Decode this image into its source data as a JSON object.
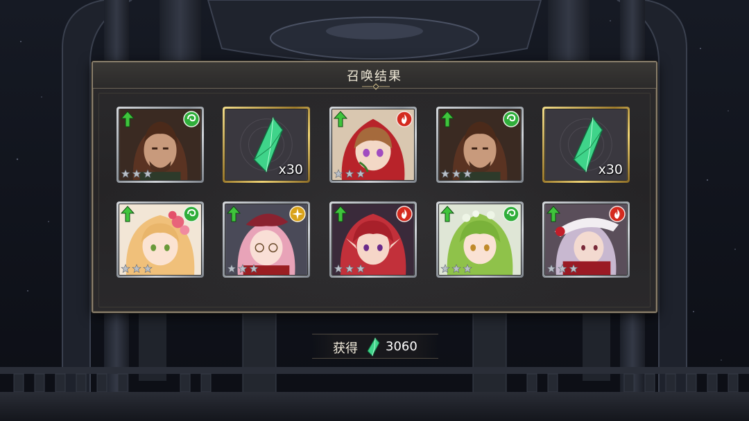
{
  "dialog": {
    "title": "召唤结果"
  },
  "results": [
    {
      "kind": "character",
      "name": "brown-haired-man",
      "element": "wind",
      "rarity_stars": 3,
      "is_new": true
    },
    {
      "kind": "crystal",
      "quantity": "x30"
    },
    {
      "kind": "character",
      "name": "red-hood-girl",
      "element": "fire",
      "rarity_stars": 3,
      "is_new": true
    },
    {
      "kind": "character",
      "name": "brown-haired-man",
      "element": "wind",
      "rarity_stars": 3,
      "is_new": true
    },
    {
      "kind": "crystal",
      "quantity": "x30"
    },
    {
      "kind": "character",
      "name": "blonde-flower-girl",
      "element": "wind",
      "rarity_stars": 3,
      "is_new": true
    },
    {
      "kind": "character",
      "name": "pink-haired-glasses-girl",
      "element": "light",
      "rarity_stars": 3,
      "is_new": true
    },
    {
      "kind": "character",
      "name": "red-haired-elf",
      "element": "fire",
      "rarity_stars": 3,
      "is_new": true
    },
    {
      "kind": "character",
      "name": "green-haired-elf",
      "element": "wind",
      "rarity_stars": 3,
      "is_new": true
    },
    {
      "kind": "character",
      "name": "silver-haired-girl-hat",
      "element": "fire",
      "rarity_stars": 3,
      "is_new": true
    }
  ],
  "obtained": {
    "label": "获得",
    "amount": "3060",
    "icon": "green-crystal-icon"
  },
  "colors": {
    "wind": "#2fae3a",
    "fire": "#d42a1f",
    "light": "#d9a21a",
    "crystal": "#3fd48a",
    "silver_frame": "#c5c9ce",
    "gold_frame": "#d9b859"
  }
}
